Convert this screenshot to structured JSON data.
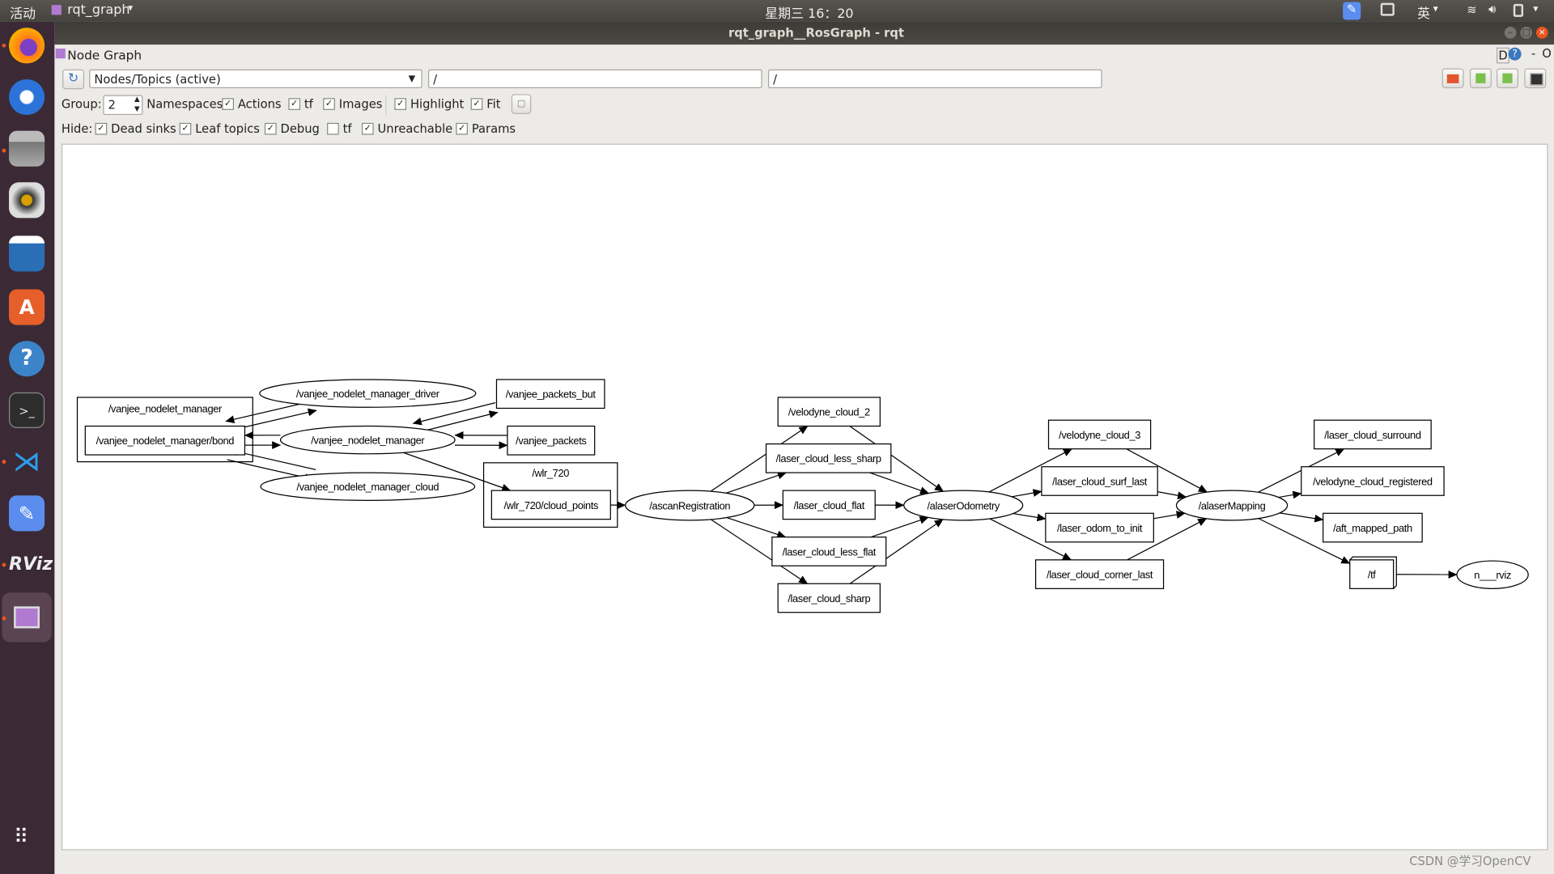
{
  "topbar": {
    "activities": "活动",
    "app_name": "rqt_graph",
    "clock": "星期三 16：20",
    "input_method": "英"
  },
  "window": {
    "title": "rqt_graph__RosGraph - rqt"
  },
  "plugin": {
    "title": "Node Graph",
    "right_controls": [
      "D",
      "?",
      "-",
      "O"
    ]
  },
  "toolbar": {
    "mode_select": "Nodes/Topics (active)",
    "node_filter": "/",
    "topic_filter": "/",
    "group_label": "Group:",
    "group_value": "2",
    "namespaces_label": "Namespaces",
    "options": [
      {
        "label": "Actions",
        "checked": true
      },
      {
        "label": "tf",
        "checked": true
      },
      {
        "label": "Images",
        "checked": true
      },
      {
        "label": "Highlight",
        "checked": true
      },
      {
        "label": "Fit",
        "checked": true
      }
    ],
    "hide_label": "Hide:",
    "hide_options": [
      {
        "label": "Dead sinks",
        "checked": true
      },
      {
        "label": "Leaf topics",
        "checked": true
      },
      {
        "label": "Debug",
        "checked": true
      },
      {
        "label": "tf",
        "checked": false
      },
      {
        "label": "Unreachable",
        "checked": true
      },
      {
        "label": "Params",
        "checked": true
      }
    ]
  },
  "dock": [
    "firefox",
    "thunderbird",
    "files",
    "rhythmbox",
    "libreoffice-writer",
    "software",
    "help",
    "terminal",
    "vscode",
    "notes",
    "rviz",
    "rqt"
  ],
  "graph": {
    "nodes": {
      "grp_mgr": "/vanjee_nodelet_manager",
      "bond": "/vanjee_nodelet_manager/bond",
      "driver": "/vanjee_nodelet_manager_driver",
      "mgr": "/vanjee_nodelet_manager",
      "cloud": "/vanjee_nodelet_manager_cloud",
      "packets_but": "/vanjee_packets_but",
      "packets": "/vanjee_packets",
      "grp_wlr": "/wlr_720",
      "cloud_points": "/wlr_720/cloud_points",
      "ascan": "/ascanRegistration",
      "v2": "/velodyne_cloud_2",
      "less_sharp": "/laser_cloud_less_sharp",
      "flat": "/laser_cloud_flat",
      "less_flat": "/laser_cloud_less_flat",
      "sharp": "/laser_cloud_sharp",
      "odom": "/alaserOdometry",
      "v3": "/velodyne_cloud_3",
      "surf": "/laser_cloud_surf_last",
      "init": "/laser_odom_to_init",
      "corner": "/laser_cloud_corner_last",
      "map": "/alaserMapping",
      "surround": "/laser_cloud_surround",
      "registered": "/velodyne_cloud_registered",
      "aft": "/aft_mapped_path",
      "tf": "/tf",
      "rviz": "n___rviz"
    },
    "edges": [
      [
        "bond",
        "driver"
      ],
      [
        "driver",
        "bond"
      ],
      [
        "bond",
        "mgr"
      ],
      [
        "mgr",
        "bond"
      ],
      [
        "bond",
        "cloud"
      ],
      [
        "cloud",
        "bond"
      ],
      [
        "mgr",
        "packets_but"
      ],
      [
        "packets_but",
        "mgr"
      ],
      [
        "mgr",
        "packets"
      ],
      [
        "packets",
        "mgr"
      ],
      [
        "mgr",
        "cloud_points"
      ],
      [
        "cloud_points",
        "ascan"
      ],
      [
        "ascan",
        "v2"
      ],
      [
        "ascan",
        "less_sharp"
      ],
      [
        "ascan",
        "flat"
      ],
      [
        "ascan",
        "less_flat"
      ],
      [
        "ascan",
        "sharp"
      ],
      [
        "v2",
        "odom"
      ],
      [
        "less_sharp",
        "odom"
      ],
      [
        "flat",
        "odom"
      ],
      [
        "less_flat",
        "odom"
      ],
      [
        "sharp",
        "odom"
      ],
      [
        "odom",
        "v3"
      ],
      [
        "odom",
        "surf"
      ],
      [
        "odom",
        "init"
      ],
      [
        "odom",
        "corner"
      ],
      [
        "v3",
        "map"
      ],
      [
        "surf",
        "map"
      ],
      [
        "init",
        "map"
      ],
      [
        "corner",
        "map"
      ],
      [
        "map",
        "surround"
      ],
      [
        "map",
        "registered"
      ],
      [
        "map",
        "aft"
      ],
      [
        "map",
        "tf"
      ],
      [
        "tf",
        "rviz"
      ]
    ]
  },
  "watermark": "CSDN @学习OpenCV"
}
